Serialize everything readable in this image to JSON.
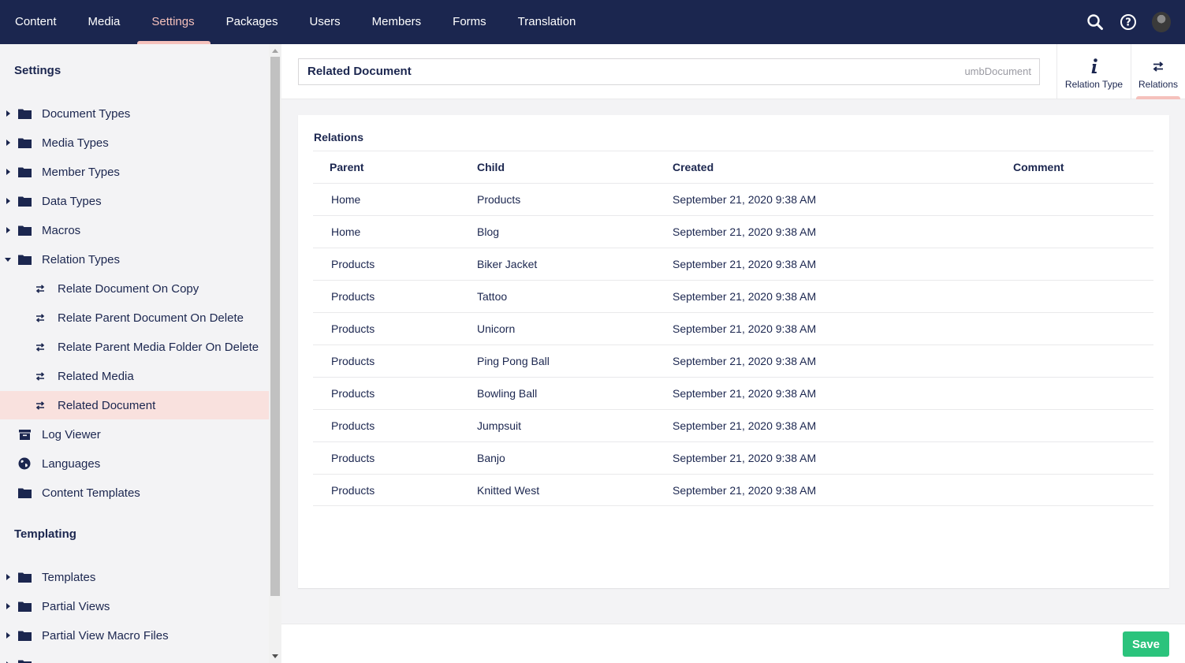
{
  "topnav": {
    "items": [
      "Content",
      "Media",
      "Settings",
      "Packages",
      "Users",
      "Members",
      "Forms",
      "Translation"
    ],
    "active": "Settings",
    "icons": [
      "search-icon",
      "help-icon",
      "avatar"
    ]
  },
  "sidebar": {
    "settings_heading": "Settings",
    "items": {
      "document_types": "Document Types",
      "media_types": "Media Types",
      "member_types": "Member Types",
      "data_types": "Data Types",
      "macros": "Macros",
      "relation_types": "Relation Types",
      "relate_document_on_copy": "Relate Document On Copy",
      "relate_parent_document_on_delete": "Relate Parent Document On Delete",
      "relate_parent_media_folder_on_delete": "Relate Parent Media Folder On Delete",
      "related_media": "Related Media",
      "related_document": "Related Document",
      "log_viewer": "Log Viewer",
      "languages": "Languages",
      "content_templates": "Content Templates",
      "templates": "Templates",
      "partial_views": "Partial Views",
      "partial_view_macro_files": "Partial View Macro Files"
    },
    "templating_heading": "Templating",
    "selected": "Related Document"
  },
  "editor": {
    "name": "Related Document",
    "alias": "umbDocument",
    "tabs": {
      "relation_type": "Relation Type",
      "relations": "Relations"
    },
    "active_tab": "Relations"
  },
  "relations": {
    "title": "Relations",
    "columns": {
      "parent": "Parent",
      "child": "Child",
      "created": "Created",
      "comment": "Comment"
    },
    "rows": [
      {
        "parent": "Home",
        "child": "Products",
        "created": "September 21, 2020 9:38 AM",
        "comment": ""
      },
      {
        "parent": "Home",
        "child": "Blog",
        "created": "September 21, 2020 9:38 AM",
        "comment": ""
      },
      {
        "parent": "Products",
        "child": "Biker Jacket",
        "created": "September 21, 2020 9:38 AM",
        "comment": ""
      },
      {
        "parent": "Products",
        "child": "Tattoo",
        "created": "September 21, 2020 9:38 AM",
        "comment": ""
      },
      {
        "parent": "Products",
        "child": "Unicorn",
        "created": "September 21, 2020 9:38 AM",
        "comment": ""
      },
      {
        "parent": "Products",
        "child": "Ping Pong Ball",
        "created": "September 21, 2020 9:38 AM",
        "comment": ""
      },
      {
        "parent": "Products",
        "child": "Bowling Ball",
        "created": "September 21, 2020 9:38 AM",
        "comment": ""
      },
      {
        "parent": "Products",
        "child": "Jumpsuit",
        "created": "September 21, 2020 9:38 AM",
        "comment": ""
      },
      {
        "parent": "Products",
        "child": "Banjo",
        "created": "September 21, 2020 9:38 AM",
        "comment": ""
      },
      {
        "parent": "Products",
        "child": "Knitted West",
        "created": "September 21, 2020 9:38 AM",
        "comment": ""
      }
    ]
  },
  "footer": {
    "save_label": "Save"
  },
  "colors": {
    "nav_bg": "#1b264f",
    "accent": "#f5c1bc",
    "selected_bg": "#f9e1de",
    "save_green": "#2bc37c"
  }
}
